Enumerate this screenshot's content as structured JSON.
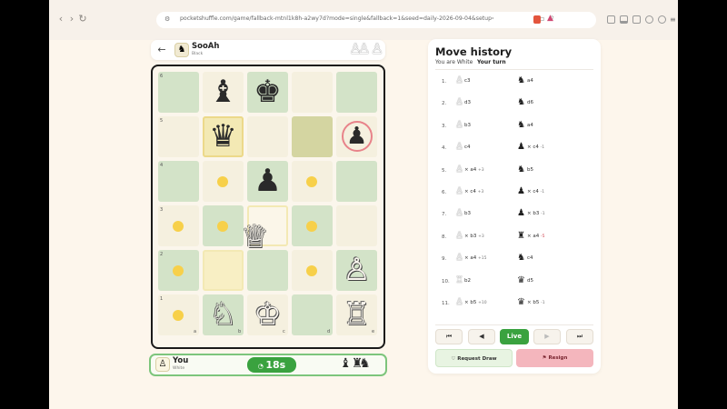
{
  "browser": {
    "url": "pocketshuffle.com/game/fallback-mtnl1k8h-a2wy7d?mode=single&fallback=1&seed=daily-2026-09-04&setup=QNK8IR&side=white&oppo..."
  },
  "opponent": {
    "name": "SooAh",
    "color": "Black"
  },
  "player": {
    "name": "You",
    "color": "White",
    "timer": "18s"
  },
  "board": {
    "ranks": [
      "6",
      "5",
      "4",
      "3",
      "2",
      "1"
    ],
    "files": [
      "a",
      "b",
      "c",
      "d",
      "e"
    ]
  },
  "history": {
    "title": "Move history",
    "status": "You are White",
    "turn": "Your turn",
    "moves": [
      {
        "num": "1.",
        "white_icon": "pawn-icon",
        "white": "c3",
        "white_delta": "",
        "black_icon": "knight-icon",
        "black": "a4",
        "black_delta": ""
      },
      {
        "num": "2.",
        "white_icon": "pawn-icon",
        "white": "d3",
        "white_delta": "",
        "black_icon": "knight-icon",
        "black": "d6",
        "black_delta": ""
      },
      {
        "num": "3.",
        "white_icon": "pawn-icon",
        "white": "b3",
        "white_delta": "",
        "black_icon": "knight-icon",
        "black": "a4",
        "black_delta": ""
      },
      {
        "num": "4.",
        "white_icon": "pawn-icon",
        "white": "c4",
        "white_delta": "",
        "black_icon": "pawn-icon",
        "black": "× c4",
        "black_delta": "-1"
      },
      {
        "num": "5.",
        "white_icon": "pawn-icon",
        "white": "× a4",
        "white_delta": "+3",
        "black_icon": "knight-icon",
        "black": "b5",
        "black_delta": ""
      },
      {
        "num": "6.",
        "white_icon": "pawn-icon",
        "white": "× c4",
        "white_delta": "+3",
        "black_icon": "pawn-icon",
        "black": "× c4",
        "black_delta": "-1"
      },
      {
        "num": "7.",
        "white_icon": "pawn-icon",
        "white": "b3",
        "white_delta": "",
        "black_icon": "pawn-icon",
        "black": "× b3",
        "black_delta": "-1"
      },
      {
        "num": "8.",
        "white_icon": "pawn-icon",
        "white": "× b3",
        "white_delta": "+3",
        "black_icon": "rook-icon",
        "black": "× a4",
        "black_delta": "-5"
      },
      {
        "num": "9.",
        "white_icon": "pawn-icon",
        "white": "× a4",
        "white_delta": "+15",
        "black_icon": "knight-icon",
        "black": "c4",
        "black_delta": ""
      },
      {
        "num": "10.",
        "white_icon": "rook-icon",
        "white": "b2",
        "white_delta": "",
        "black_icon": "queen-icon",
        "black": "d5",
        "black_delta": ""
      },
      {
        "num": "11.",
        "white_icon": "pawn-icon",
        "white": "× b5",
        "white_delta": "+10",
        "black_icon": "queen-icon",
        "black": "× b5",
        "black_delta": "-1"
      }
    ],
    "controls": {
      "first": "⏮",
      "prev": "◀",
      "live": "Live",
      "next": "▶",
      "last": "⏭"
    },
    "draw_label": "Request Draw",
    "resign_label": "Resign"
  },
  "colors": {
    "live_green": "#3aa23f",
    "resign_pink": "#f4b6bd",
    "draw_green": "#e8f4e2",
    "dark_square": "#d3e3c8",
    "light_square": "#f5f0df",
    "move_dot": "#f7d04a"
  }
}
